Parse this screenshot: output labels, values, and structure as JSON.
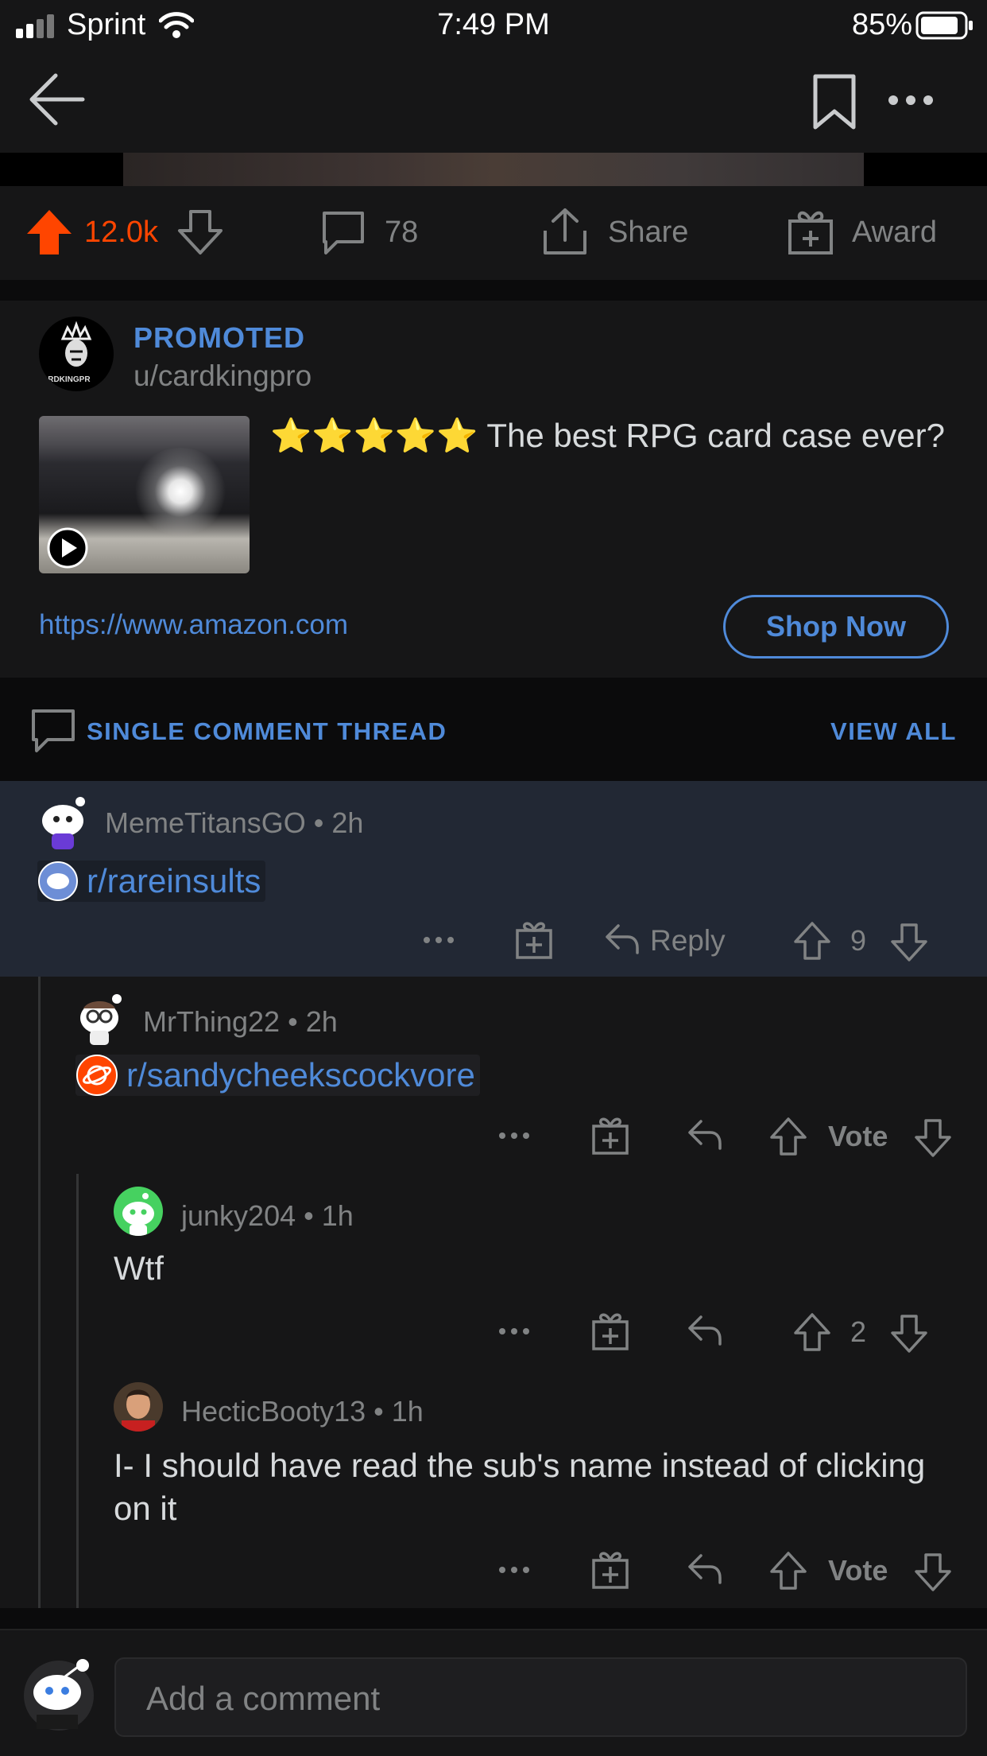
{
  "status_bar": {
    "carrier": "Sprint",
    "time": "7:49 PM",
    "battery": "85%"
  },
  "post_actions": {
    "upvotes": "12.0k",
    "comments": "78",
    "share": "Share",
    "award": "Award"
  },
  "promoted": {
    "label": "PROMOTED",
    "user": "u/cardkingpro",
    "logo_text": "ARDKINGPR",
    "title": "⭐⭐⭐⭐⭐ The best RPG card case ever?",
    "link": "https://www.amazon.com",
    "cta": "Shop Now"
  },
  "thread_bar": {
    "label": "SINGLE COMMENT THREAD",
    "view_all": "VIEW ALL"
  },
  "comments": [
    {
      "author": "MemeTitansGO",
      "time": "2h",
      "subreddit": "r/rareinsults",
      "votes": "9",
      "reply_label": "Reply"
    },
    {
      "author": "MrThing22",
      "time": "2h",
      "subreddit": "r/sandycheekscockvore",
      "votes": "Vote"
    },
    {
      "author": "junky204",
      "time": "1h",
      "body": "Wtf",
      "votes": "2"
    },
    {
      "author": "HecticBooty13",
      "time": "1h",
      "body": "I- I should have read the sub's name instead of clicking on it",
      "votes": "Vote"
    }
  ],
  "composer": {
    "placeholder": "Add a comment"
  },
  "colors": {
    "upvote_accent": "#ff4500",
    "link_blue": "#4f8ad9",
    "highlight_bg": "#222834"
  },
  "icons": [
    "back-arrow-icon",
    "bookmark-icon",
    "more-icon",
    "upvote-icon",
    "downvote-icon",
    "comment-icon",
    "share-icon",
    "award-icon",
    "reply-icon",
    "play-icon"
  ]
}
